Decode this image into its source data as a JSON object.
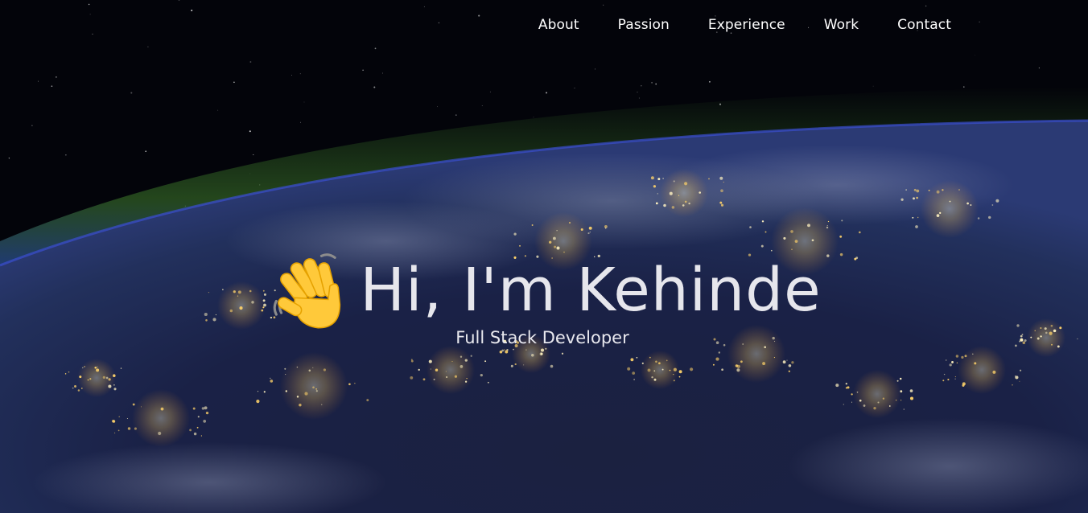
{
  "nav": {
    "items": [
      {
        "label": "About"
      },
      {
        "label": "Passion"
      },
      {
        "label": "Experience"
      },
      {
        "label": "Work"
      },
      {
        "label": "Contact"
      }
    ]
  },
  "hero": {
    "wave_icon": "waving-hand-emoji",
    "title": "Hi, I'm Kehinde",
    "subtitle": "Full Stack Developer",
    "background": "earth-at-night-from-space",
    "colors": {
      "space": "#03040a",
      "atmosphere": "#2f6a22",
      "city_lights": "#ffcf5a"
    }
  }
}
